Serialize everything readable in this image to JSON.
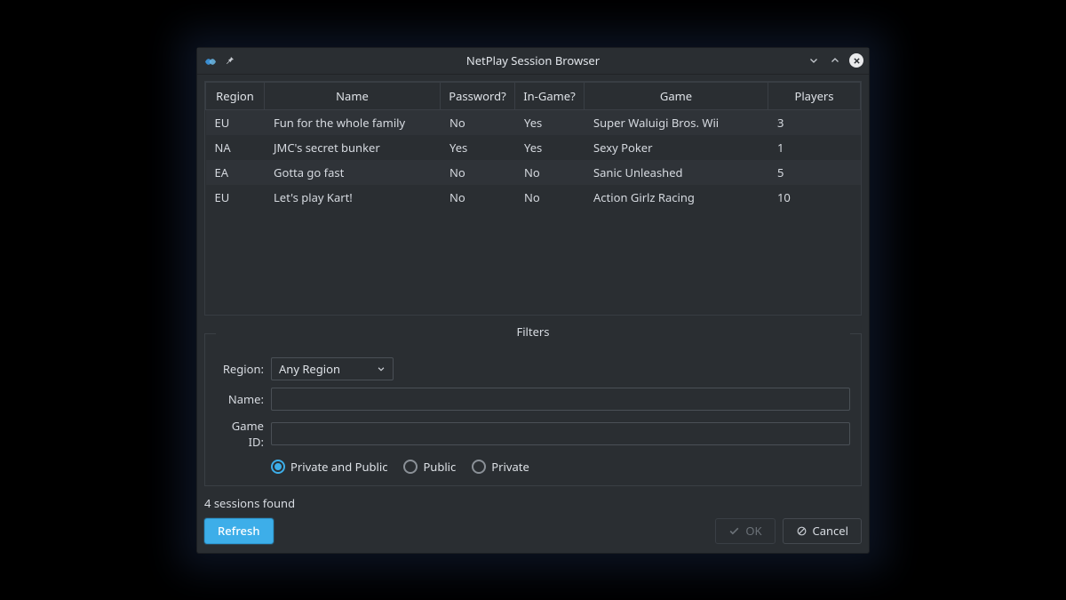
{
  "window": {
    "title": "NetPlay Session Browser"
  },
  "table": {
    "headers": [
      "Region",
      "Name",
      "Password?",
      "In-Game?",
      "Game",
      "Players"
    ],
    "rows": [
      {
        "region": "EU",
        "name": "Fun for the whole family",
        "password": "No",
        "ingame": "Yes",
        "game": "Super Waluigi Bros. Wii",
        "players": "3"
      },
      {
        "region": "NA",
        "name": "JMC's secret bunker",
        "password": "Yes",
        "ingame": "Yes",
        "game": "Sexy Poker",
        "players": "1"
      },
      {
        "region": "EA",
        "name": "Gotta go fast",
        "password": "No",
        "ingame": "No",
        "game": "Sanic Unleashed",
        "players": "5"
      },
      {
        "region": "EU",
        "name": "Let's play Kart!",
        "password": "No",
        "ingame": "No",
        "game": "Action Girlz Racing",
        "players": "10"
      }
    ]
  },
  "filters": {
    "legend": "Filters",
    "region_label": "Region:",
    "region_value": "Any Region",
    "name_label": "Name:",
    "name_value": "",
    "gameid_label": "Game ID:",
    "gameid_value": "",
    "privacy": {
      "both": "Private and Public",
      "public": "Public",
      "private": "Private",
      "selected": "both"
    }
  },
  "status": "4 sessions found",
  "buttons": {
    "refresh": "Refresh",
    "ok": "OK",
    "cancel": "Cancel"
  }
}
